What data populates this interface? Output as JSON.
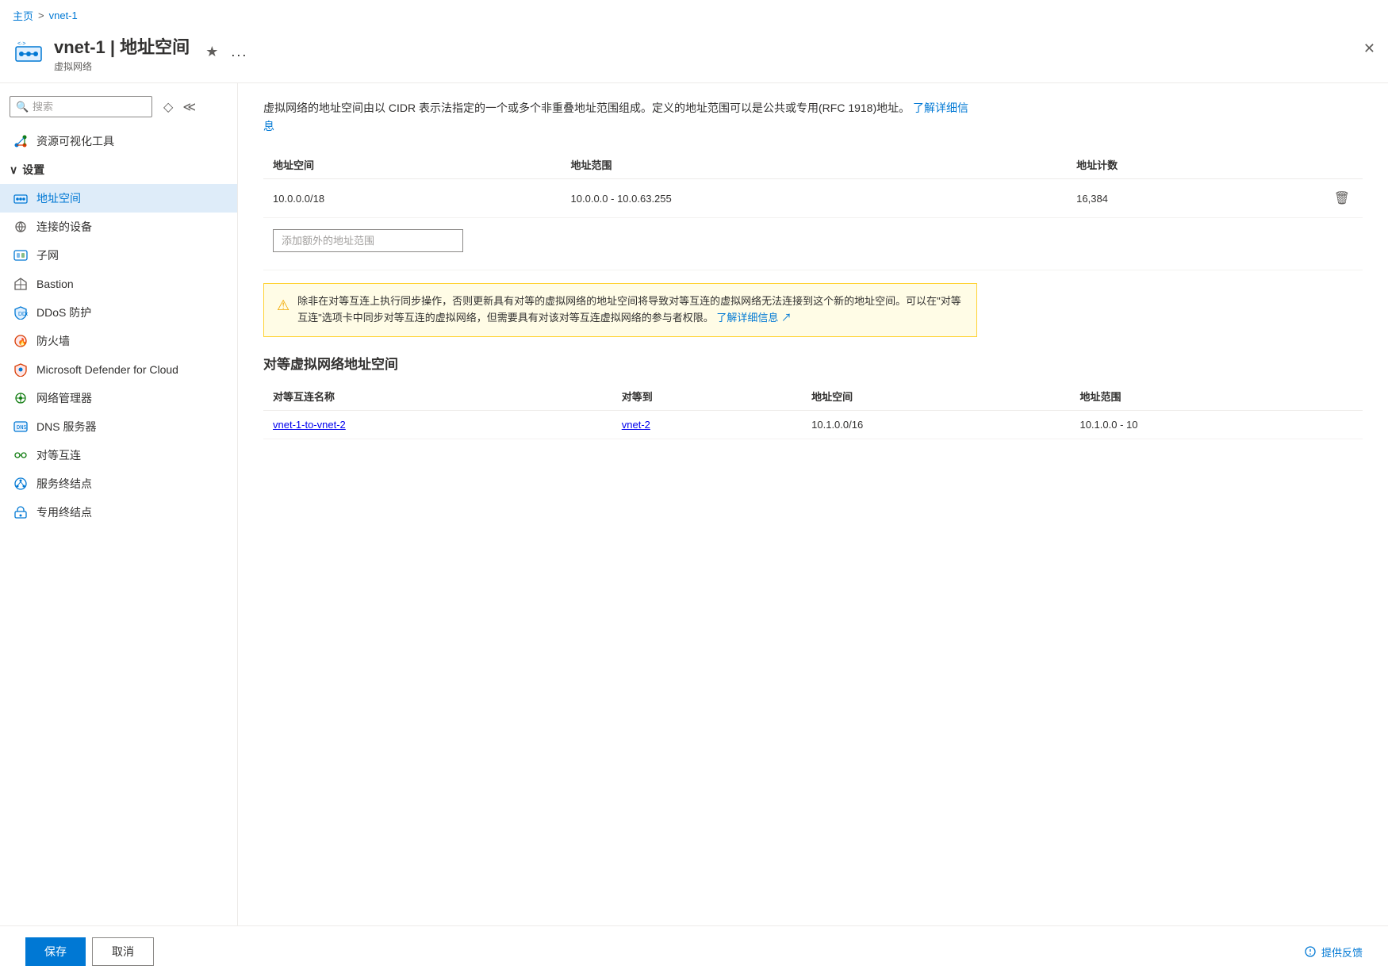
{
  "breadcrumb": {
    "home": "主页",
    "separator": ">",
    "current": "vnet-1"
  },
  "header": {
    "icon_alt": "vnet-icon",
    "title": "vnet-1 | 地址空间",
    "subtitle": "虚拟网络",
    "star_label": "★",
    "more_label": "...",
    "close_label": "✕"
  },
  "sidebar": {
    "search_placeholder": "搜索",
    "items": [
      {
        "id": "resource-viz",
        "label": "资源可视化工具",
        "icon": "graph"
      },
      {
        "id": "settings-section",
        "label": "设置",
        "icon": "chevron",
        "is_section": true
      },
      {
        "id": "address-space",
        "label": "地址空间",
        "icon": "vnet",
        "active": true
      },
      {
        "id": "connected-devices",
        "label": "连接的设备",
        "icon": "devices"
      },
      {
        "id": "subnet",
        "label": "子网",
        "icon": "subnet"
      },
      {
        "id": "bastion",
        "label": "Bastion",
        "icon": "bastion"
      },
      {
        "id": "ddos",
        "label": "DDoS 防护",
        "icon": "shield"
      },
      {
        "id": "firewall",
        "label": "防火墙",
        "icon": "firewall"
      },
      {
        "id": "defender",
        "label": "Microsoft Defender for Cloud",
        "icon": "defender"
      },
      {
        "id": "network-manager",
        "label": "网络管理器",
        "icon": "network-mgr"
      },
      {
        "id": "dns",
        "label": "DNS 服务器",
        "icon": "dns"
      },
      {
        "id": "peerings",
        "label": "对等互连",
        "icon": "peering"
      },
      {
        "id": "service-endpoints",
        "label": "服务终结点",
        "icon": "service-ep"
      },
      {
        "id": "private-endpoints",
        "label": "专用终结点",
        "icon": "private-ep"
      }
    ]
  },
  "content": {
    "description": "虚拟网络的地址空间由以 CIDR 表示法指定的一个或多个非重叠地址范围组成。定义的地址范围可以是公共或专用(RFC 1918)地址。",
    "learn_more_link": "了解详细信息",
    "table": {
      "columns": [
        "地址空间",
        "地址范围",
        "地址计数"
      ],
      "rows": [
        {
          "address_space": "10.0.0.0/18",
          "address_range": "10.0.0.0 - 10.0.63.255",
          "address_count": "16,384"
        }
      ]
    },
    "add_range_placeholder": "添加额外的地址范围",
    "warning": {
      "text": "除非在对等互连上执行同步操作，否则更新具有对等的虚拟网络的地址空间将导致对等互连的虚拟网络无法连接到这个新的地址空间。可以在\"对等互连\"选项卡中同步对等互连的虚拟网络，但需要具有对该对等互连虚拟网络的参与者权限。",
      "learn_more": "了解详细信息"
    },
    "peering_section": {
      "title": "对等虚拟网络地址空间",
      "columns": [
        "对等互连名称",
        "对等到",
        "地址空间",
        "地址范围"
      ],
      "rows": [
        {
          "peering_name": "vnet-1-to-vnet-2",
          "peer_to": "vnet-2",
          "address_space": "10.1.0.0/16",
          "address_range": "10.1.0.0 - 10"
        }
      ]
    }
  },
  "footer": {
    "save_label": "保存",
    "cancel_label": "取消",
    "feedback_label": "提供反馈"
  }
}
